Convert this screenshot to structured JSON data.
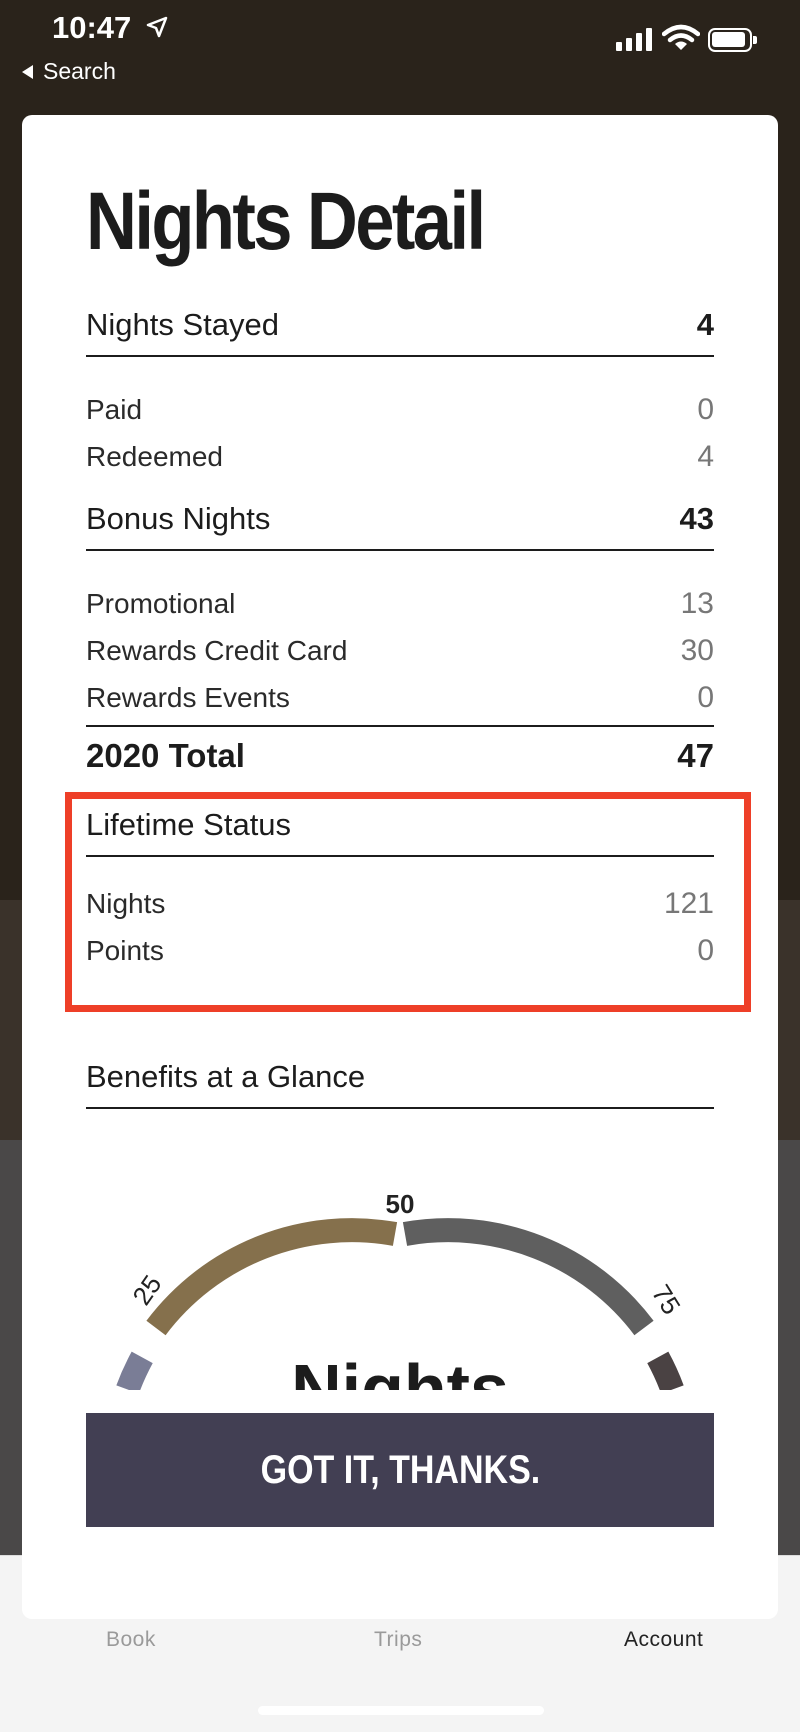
{
  "status_bar": {
    "time": "10:47",
    "back_label": "Search"
  },
  "tab_bar": {
    "items": [
      "Book",
      "Trips",
      "Account"
    ]
  },
  "modal": {
    "title": "Nights Detail",
    "nights_stayed": {
      "label": "Nights Stayed",
      "value": "4",
      "items": [
        {
          "label": "Paid",
          "value": "0"
        },
        {
          "label": "Redeemed",
          "value": "4"
        }
      ]
    },
    "bonus_nights": {
      "label": "Bonus Nights",
      "value": "43",
      "items": [
        {
          "label": "Promotional",
          "value": "13"
        },
        {
          "label": "Rewards Credit Card",
          "value": "30"
        },
        {
          "label": "Rewards Events",
          "value": "0"
        }
      ]
    },
    "total": {
      "label": "2020 Total",
      "value": "47"
    },
    "lifetime": {
      "label": "Lifetime Status",
      "items": [
        {
          "label": "Nights",
          "value": "121"
        },
        {
          "label": "Points",
          "value": "0"
        }
      ]
    },
    "benefits": {
      "label": "Benefits at a Glance",
      "gauge": {
        "tick_labels": [
          "25",
          "50",
          "75"
        ],
        "center_text": "Nights",
        "colors": {
          "low": "#7a7d96",
          "mid": "#85704c",
          "high": "#5f5f5f",
          "top": "#4a4243"
        }
      }
    },
    "button_label": "GOT IT, THANKS."
  },
  "colors": {
    "highlight": "#ee3f28",
    "button": "#423f53"
  }
}
